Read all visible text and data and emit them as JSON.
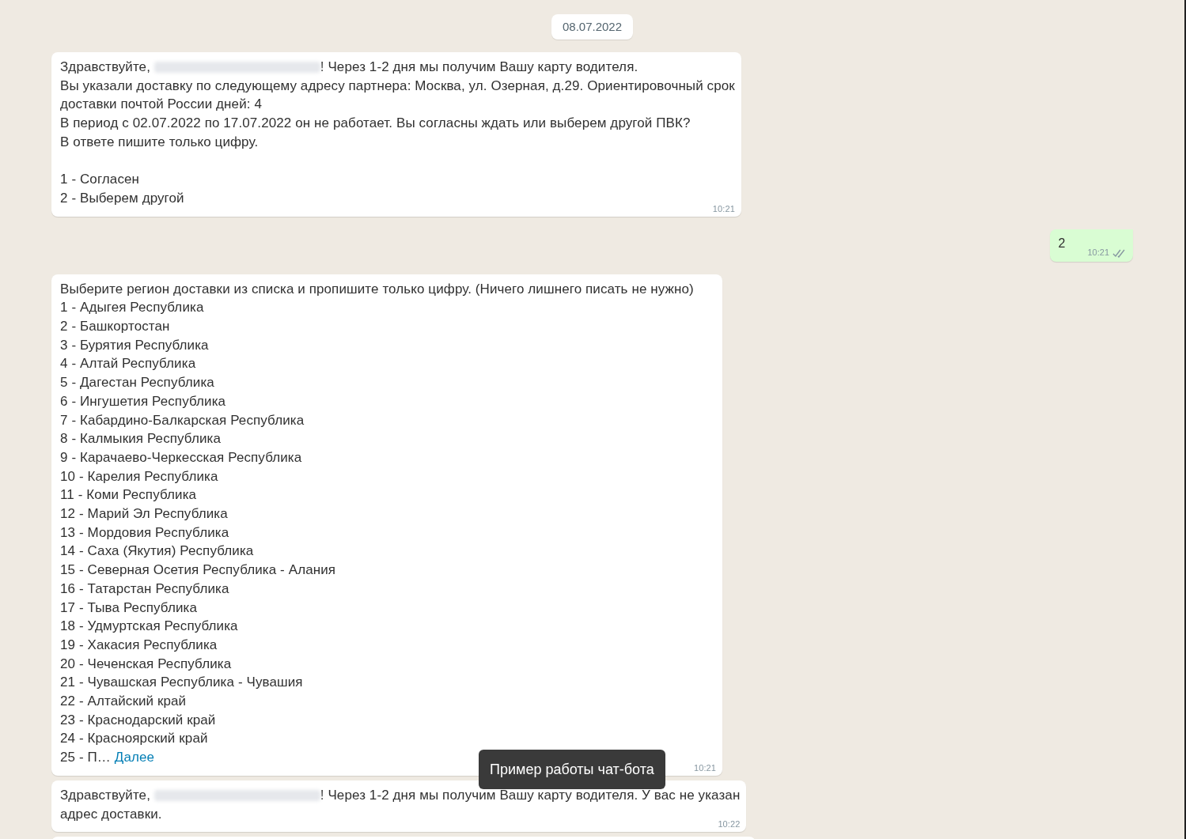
{
  "date_badge": "08.07.2022",
  "messages": [
    {
      "kind": "incoming",
      "greeting": {
        "before": "Здравствуйте, ",
        "after": "! Через 1-2 дня мы получим Вашу карту водителя."
      },
      "paragraphs": [
        [
          "Вы указали доставку по следующему адресу партнера: Москва, ул. Озерная, д.29. Ориентировочный срок",
          "доставки почтой России дней: 4",
          "В период с 02.07.2022 по 17.07.2022 он не работает. Вы согласны ждать или выберем другой ПВК?",
          "В ответе пишите только цифру."
        ],
        [
          "1 - Согласен",
          "2 - Выберем другой"
        ]
      ],
      "time": "10:21"
    },
    {
      "kind": "outgoing",
      "text": "2",
      "time": "10:21",
      "read": false
    },
    {
      "kind": "incoming",
      "paragraphs": [
        [
          "Выберите регион доставки из списка и пропишите только цифру. (Ничего лишнего писать не нужно)",
          "1 - Адыгея Республика",
          "2 - Башкортостан",
          "3 - Бурятия Республика",
          "4 - Алтай Республика",
          "5 - Дагестан Республика",
          "6 - Ингушетия Республика",
          "7 - Кабардино-Балкарская Республика",
          "8 - Калмыкия Республика",
          "9 - Карачаево-Черкесская Республика",
          "10 - Карелия Республика",
          "11 - Коми Республика",
          "12 - Марий Эл Республика",
          "13 - Мордовия Республика",
          "14 - Саха (Якутия) Республика",
          "15 - Северная Осетия Республика - Алания",
          "16 - Татарстан Республика",
          "17 - Тыва Республика",
          "18 - Удмуртская Республика",
          "19 - Хакасия Республика",
          "20 - Чеченская Республика",
          "21 - Чувашская Республика - Чувашия",
          "22 - Алтайский край",
          "23 - Краснодарский край",
          "24 - Красноярский край"
        ]
      ],
      "more": {
        "text": "25 - П…",
        "link": "Далее"
      },
      "time": "10:21"
    },
    {
      "kind": "incoming",
      "greeting": {
        "before": "Здравствуйте, ",
        "after": "! Через 1-2 дня мы получим Вашу карту водителя. У вас не указан"
      },
      "paragraphs": [
        [
          "адрес доставки."
        ]
      ],
      "time": "10:22"
    }
  ],
  "caption": "Пример работы чат-бота"
}
